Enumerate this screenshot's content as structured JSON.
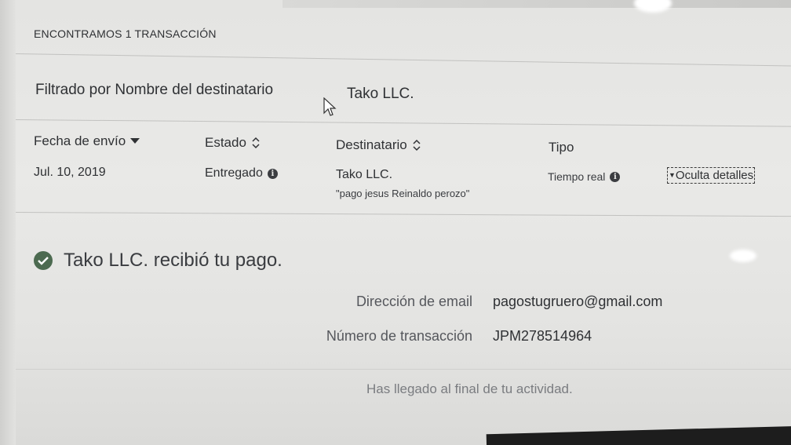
{
  "header": {
    "count_text": "ENCONTRAMOS 1 TRANSACCIÓN"
  },
  "filter": {
    "label": "Filtrado por Nombre del destinatario",
    "value": "Tako LLC."
  },
  "table": {
    "columns": {
      "date": "Fecha de envío",
      "status": "Estado",
      "recipient": "Destinatario",
      "type": "Tipo"
    },
    "sort_icons": {
      "date": "caret-down-icon",
      "status": "sort-updown-icon",
      "recipient": "sort-updown-icon"
    },
    "row": {
      "date": "Jul. 10, 2019",
      "status": "Entregado",
      "recipient": "Tako LLC.",
      "note": "\"pago jesus Reinaldo perozo\"",
      "type": "Tiempo real",
      "toggle_label": "Oculta detalles"
    }
  },
  "details": {
    "success_message": "Tako LLC. recibió tu pago.",
    "email_label": "Dirección de email",
    "email_value": "pagostugruero@gmail.com",
    "txn_label": "Número de transacción",
    "txn_value": "JPM278514964"
  },
  "footer": {
    "end_message": "Has llegado al final de tu actividad."
  },
  "colors": {
    "success_green": "#4c6a50",
    "text": "#2f3134",
    "muted": "#7a7c80"
  }
}
